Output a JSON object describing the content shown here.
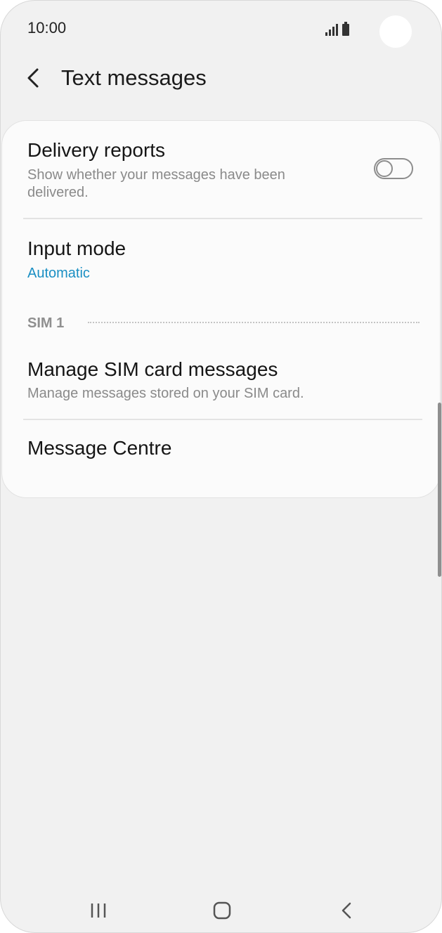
{
  "status_bar": {
    "time": "10:00",
    "icons": [
      "signal-icon",
      "battery-icon"
    ]
  },
  "header": {
    "back_icon": "chevron-left-icon",
    "title": "Text messages"
  },
  "settings": {
    "delivery_reports": {
      "title": "Delivery reports",
      "subtitle": "Show whether your messages have been delivered.",
      "enabled": false
    },
    "input_mode": {
      "title": "Input mode",
      "value": "Automatic"
    },
    "section_sim": {
      "label": "SIM 1"
    },
    "manage_sim": {
      "title": "Manage SIM card messages",
      "subtitle": "Manage messages stored on your SIM card."
    },
    "message_centre": {
      "title": "Message Centre"
    }
  },
  "nav_bar": {
    "buttons": [
      "recent-apps-icon",
      "home-icon",
      "back-icon"
    ]
  },
  "colors": {
    "accent": "#1a8fc3",
    "background": "#f1f1f1",
    "card": "#fbfbfb"
  }
}
